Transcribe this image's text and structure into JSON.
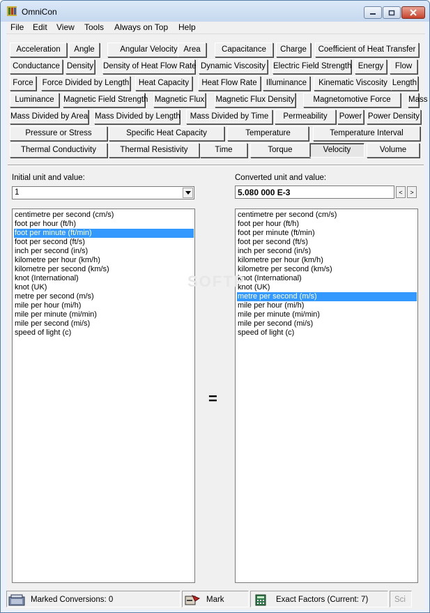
{
  "window": {
    "title": "OmniCon"
  },
  "menu": [
    "File",
    "Edit",
    "View",
    "Tools",
    "Always on Top",
    "Help"
  ],
  "categories": [
    "Acceleration",
    "Angle",
    "Angular Velocity",
    "Area",
    "Capacitance",
    "Charge",
    "Coefficient of Heat Transfer",
    "Conductance",
    "Density",
    "Density of Heat Flow Rate",
    "Dynamic Viscosity",
    "Electric Field Strength",
    "Energy",
    "Flow",
    "Force",
    "Force Divided by Length",
    "Heat Capacity",
    "Heat Flow Rate",
    "Illuminance",
    "Kinematic Viscosity",
    "Length",
    "Luminance",
    "Magnetic Field Strength",
    "Magnetic Flux",
    "Magnetic Flux Density",
    "Magnetomotive Force",
    "Mass",
    "Mass Divided by Area",
    "Mass Divided by Length",
    "Mass Divided by Time",
    "Permeability",
    "Power",
    "Power Density",
    "Pressure or Stress",
    "Specific Heat Capacity",
    "Temperature",
    "Temperature Interval",
    "Thermal Conductivity",
    "Thermal Resistivity",
    "Time",
    "Torque",
    "Velocity",
    "Volume"
  ],
  "active_category": "Velocity",
  "input": {
    "label": "Initial unit and value:",
    "value": "1"
  },
  "output": {
    "label": "Converted unit and value:",
    "value": "5.080 000 E-3",
    "prev": "<",
    "next": ">"
  },
  "equals_sign": "=",
  "watermark": "SOFTP",
  "units": [
    "centimetre per second (cm/s)",
    "foot per hour (ft/h)",
    "foot per minute (ft/min)",
    "foot per second (ft/s)",
    "inch per second (in/s)",
    "kilometre per hour (km/h)",
    "kilometre per second (km/s)",
    "knot (International)",
    "knot (UK)",
    "metre per second (m/s)",
    "mile per hour (mi/h)",
    "mile per minute (mi/min)",
    "mile per second (mi/s)",
    "speed of light (c)"
  ],
  "left_selected_index": 2,
  "right_selected_index": 9,
  "status": {
    "marked": "Marked Conversions: 0",
    "mark": "Mark",
    "exact": "Exact Factors  (Current: 7)",
    "sci": "Sci"
  }
}
